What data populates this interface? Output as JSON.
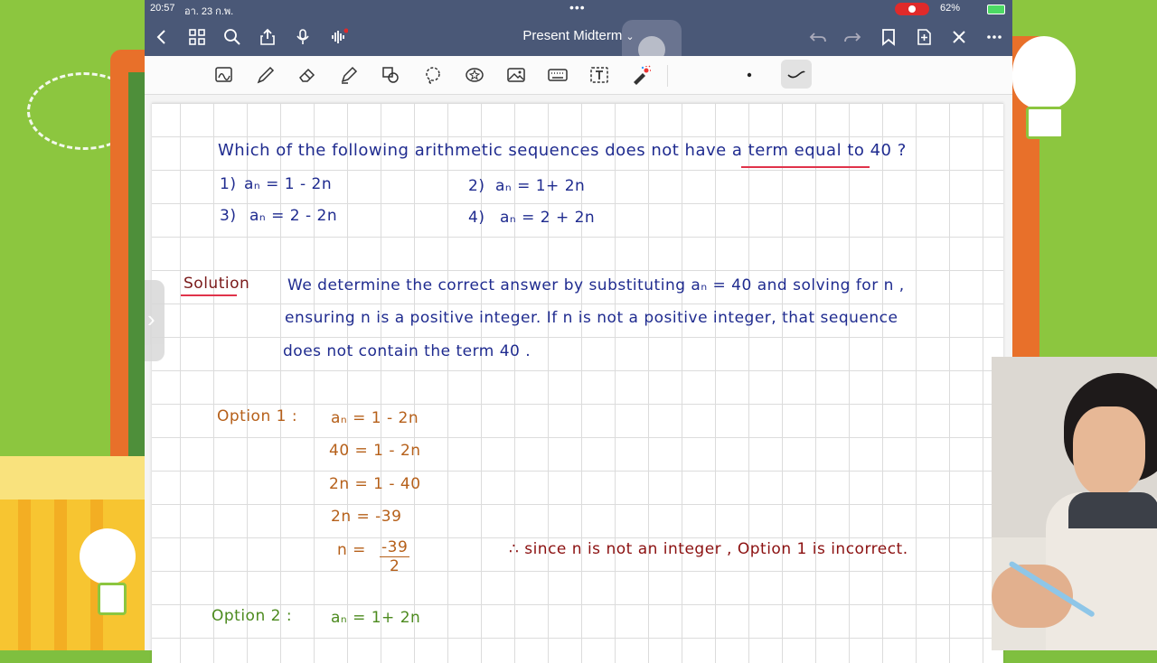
{
  "status": {
    "time": "20:57",
    "date": "อา. 23 ก.พ.",
    "battery": "62%"
  },
  "nav": {
    "title": "Present Midterm"
  },
  "toolbar": {
    "tools": [
      "lasso-ocr",
      "pen",
      "eraser",
      "highlighter",
      "shapes",
      "lasso",
      "sticker",
      "image",
      "keyboard",
      "text",
      "laser-pointer"
    ]
  },
  "question": {
    "text": "Which of the following arithmetic sequences does not have a term equal to 40 ?",
    "options": [
      {
        "num": "1)",
        "expr": "aₙ = 1 - 2n"
      },
      {
        "num": "2)",
        "expr": "aₙ = 1+ 2n"
      },
      {
        "num": "3)",
        "expr": "aₙ = 2 - 2n"
      },
      {
        "num": "4)",
        "expr": "aₙ = 2 + 2n"
      }
    ]
  },
  "solution": {
    "label": "Solution",
    "line1": "We determine the correct answer by substituting aₙ = 40 and solving for n ,",
    "line2": "ensuring n is a positive integer. If n is not a positive integer, that sequence",
    "line3": "does not contain the term 40 ."
  },
  "option1": {
    "label": "Option 1 :",
    "steps": [
      "aₙ = 1 - 2n",
      "40 = 1 - 2n",
      "2n = 1 - 40",
      "2n = -39"
    ],
    "final_left": "n =",
    "final_num": "-39",
    "final_den": "2",
    "conclusion": "∴ since n is not an integer , Option 1 is incorrect."
  },
  "option2": {
    "label": "Option 2 :",
    "steps": [
      "aₙ = 1+ 2n"
    ]
  },
  "colors": {
    "navbar": "#4a5877",
    "question_ink": "#1f2b8f",
    "option1_ink": "#b6601a",
    "conclusion_ink": "#8b1010",
    "option2_ink": "#4c8a1e"
  }
}
